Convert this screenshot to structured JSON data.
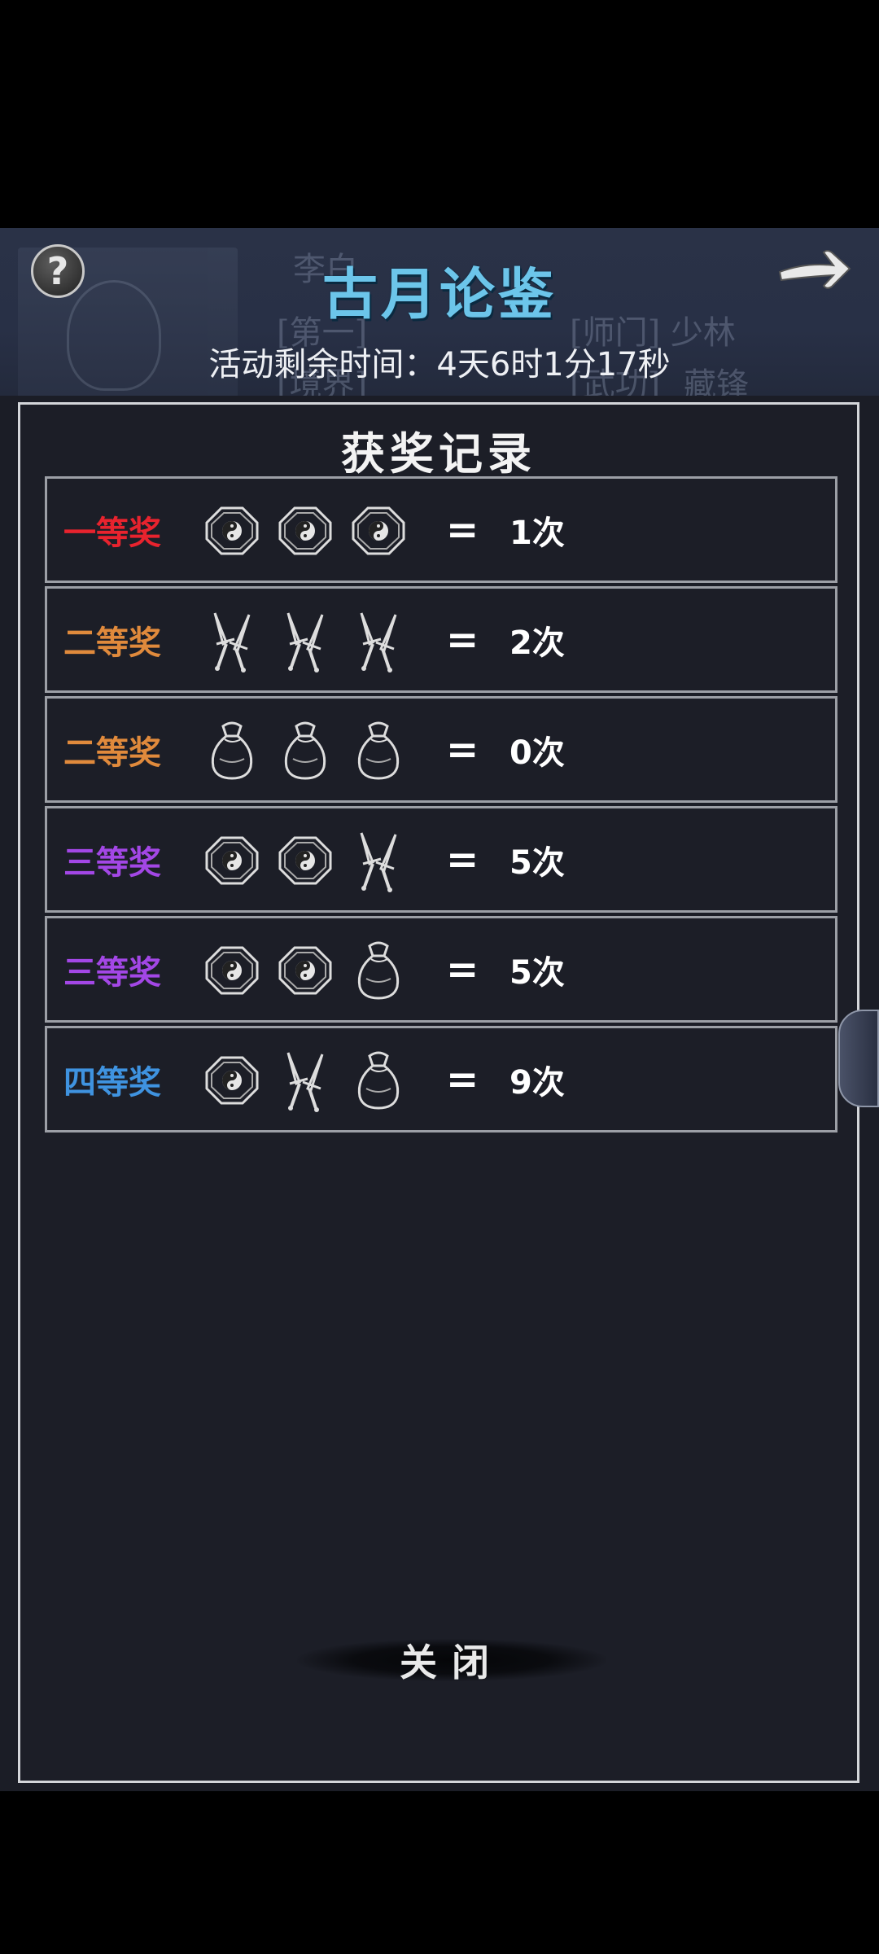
{
  "header": {
    "title": "古月论鉴",
    "timer_text": "活动剩余时间：4天6时1分17秒",
    "background_text": [
      "李白",
      "[第一]",
      "[师门] 少林",
      "[境界]",
      "[武功]",
      "藏锋"
    ]
  },
  "panel": {
    "title": "获奖记录",
    "rows": [
      {
        "label": "一等奖",
        "color": "#e8232e",
        "icons": [
          "bagua-icon",
          "bagua-icon",
          "bagua-icon"
        ],
        "equals": "=",
        "count": "1次"
      },
      {
        "label": "二等奖",
        "color": "#e08a3c",
        "icons": [
          "crossed-swords-icon",
          "crossed-swords-icon",
          "crossed-swords-icon"
        ],
        "equals": "=",
        "count": "2次"
      },
      {
        "label": "二等奖",
        "color": "#e08a3c",
        "icons": [
          "pouch-icon",
          "pouch-icon",
          "pouch-icon"
        ],
        "equals": "=",
        "count": "0次"
      },
      {
        "label": "三等奖",
        "color": "#a347e6",
        "icons": [
          "bagua-icon",
          "bagua-icon",
          "crossed-swords-icon"
        ],
        "equals": "=",
        "count": "5次"
      },
      {
        "label": "三等奖",
        "color": "#a347e6",
        "icons": [
          "bagua-icon",
          "bagua-icon",
          "pouch-icon"
        ],
        "equals": "=",
        "count": "5次"
      },
      {
        "label": "四等奖",
        "color": "#3f93e0",
        "icons": [
          "bagua-icon",
          "crossed-swords-icon",
          "pouch-icon"
        ],
        "equals": "=",
        "count": "9次"
      }
    ],
    "close_label": "关闭"
  },
  "buttons": {
    "help_icon": "question-icon",
    "next_icon": "arrow-right-icon"
  }
}
